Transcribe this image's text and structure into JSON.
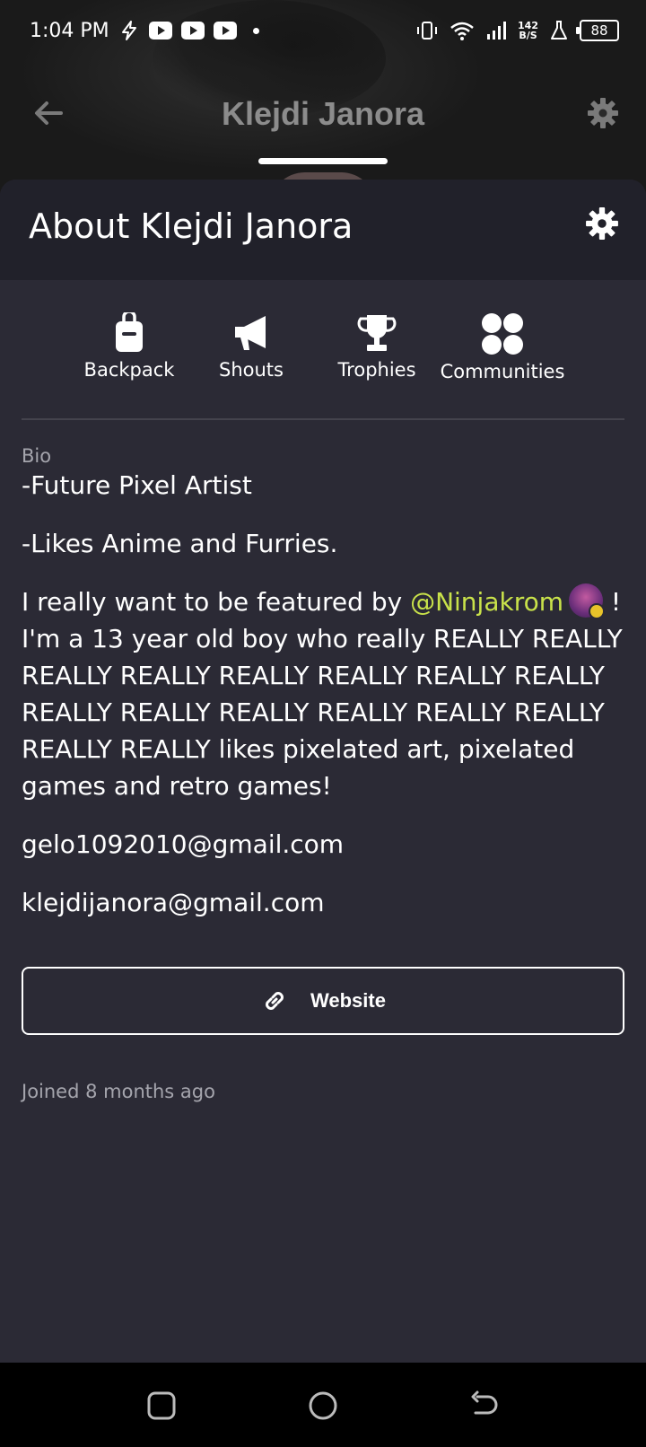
{
  "status_bar": {
    "time": "1:04 PM",
    "net_speed_value": "142",
    "net_speed_unit": "B/S",
    "battery": "88"
  },
  "profile_header": {
    "title": "Klejdi Janora"
  },
  "sheet": {
    "title": "About Klejdi Janora",
    "tabs": [
      {
        "label": "Backpack",
        "icon": "backpack-icon"
      },
      {
        "label": "Shouts",
        "icon": "megaphone-icon"
      },
      {
        "label": "Trophies",
        "icon": "trophy-icon"
      },
      {
        "label": "Communities",
        "icon": "communities-icon"
      }
    ],
    "bio_label": "Bio",
    "bio": {
      "line1": "-Future Pixel Artist",
      "line2": "-Likes Anime and Furries.",
      "p3_before": "I really want to be featured by ",
      "p3_mention": "@Ninjakrom",
      "p3_after": " ! I'm a 13 year old boy who really REALLY REALLY REALLY REALLY REALLY REALLY REALLY REALLY REALLY REALLY REALLY REALLY REALLY REALLY REALLY REALLY likes pixelated art, pixelated games and retro games!",
      "email1": "gelo1092010@gmail.com",
      "email2": "klejdijanora@gmail.com"
    },
    "website_label": "Website",
    "joined": "Joined 8 months ago"
  },
  "colors": {
    "background": "#2b2a35",
    "header": "#21212a",
    "mention": "#c9e24a",
    "muted": "#a5a5ad"
  }
}
